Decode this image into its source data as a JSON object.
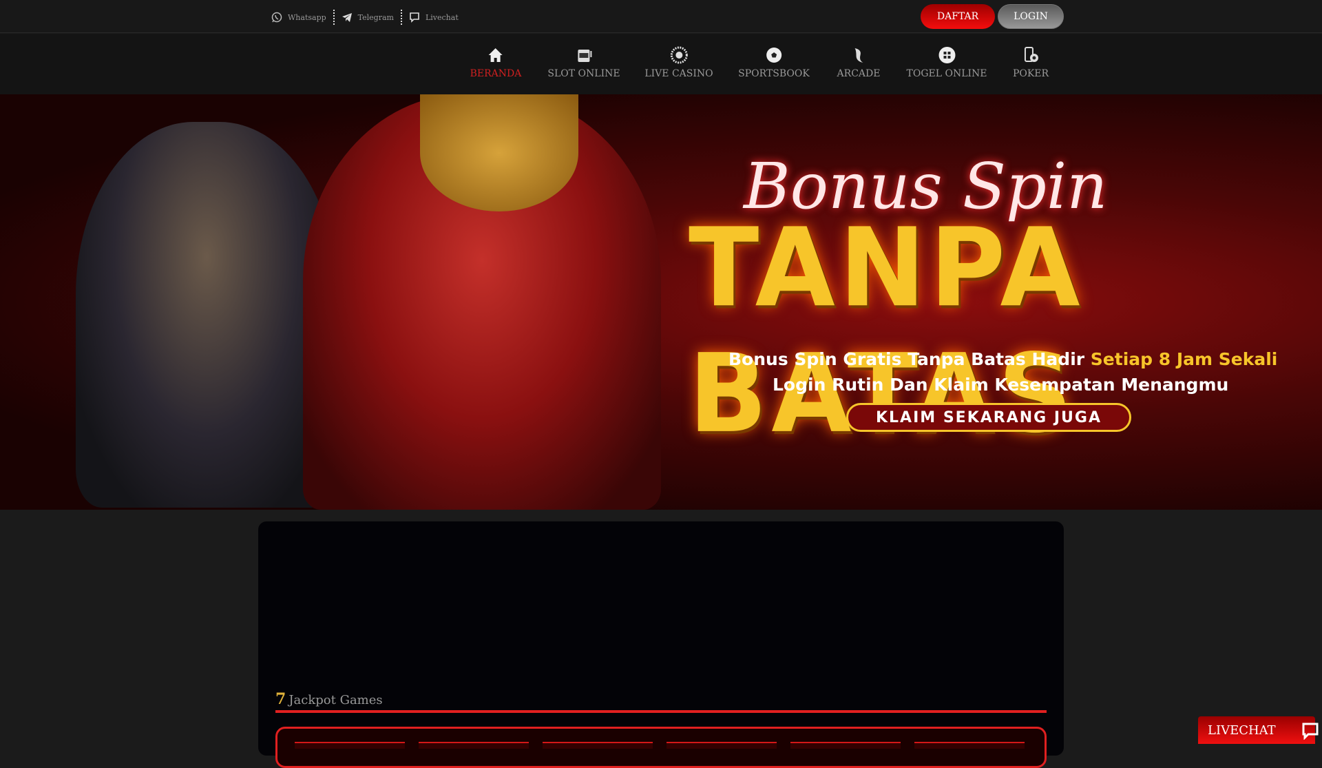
{
  "topbar": {
    "contacts": [
      {
        "label": "Whatsapp",
        "icon": "whatsapp-icon"
      },
      {
        "label": "Telegram",
        "icon": "telegram-icon"
      },
      {
        "label": "Livechat",
        "icon": "chat-icon"
      }
    ],
    "daftar": "DAFTAR",
    "login": "LOGIN"
  },
  "nav": {
    "items": [
      {
        "label": "BERANDA",
        "icon": "home-icon",
        "active": true
      },
      {
        "label": "SLOT ONLINE",
        "icon": "slot-machine-icon"
      },
      {
        "label": "LIVE CASINO",
        "icon": "roulette-icon"
      },
      {
        "label": "SPORTSBOOK",
        "icon": "soccer-ball-icon"
      },
      {
        "label": "ARCADE",
        "icon": "fish-icon"
      },
      {
        "label": "TOGEL ONLINE",
        "icon": "lottery-icon"
      },
      {
        "label": "POKER",
        "icon": "poker-icon"
      }
    ]
  },
  "banner": {
    "title1": "Bonus Spin",
    "title2": "TANPA BATAS",
    "line1_a": "Bonus Spin Gratis Tanpa Batas Hadir ",
    "line1_b": "Setiap 8 Jam Sekali",
    "line2": "Login Rutin Dan Klaim Kesempatan Menangmu",
    "cta": "KLAIM SEKARANG JUGA"
  },
  "jackpot": {
    "icon": "7",
    "title": "Jackpot Games"
  },
  "livechat": {
    "label": "LIVECHAT"
  },
  "colors": {
    "accent": "#e02020",
    "gold": "#f7c52a",
    "bg": "#1b1b1b"
  }
}
